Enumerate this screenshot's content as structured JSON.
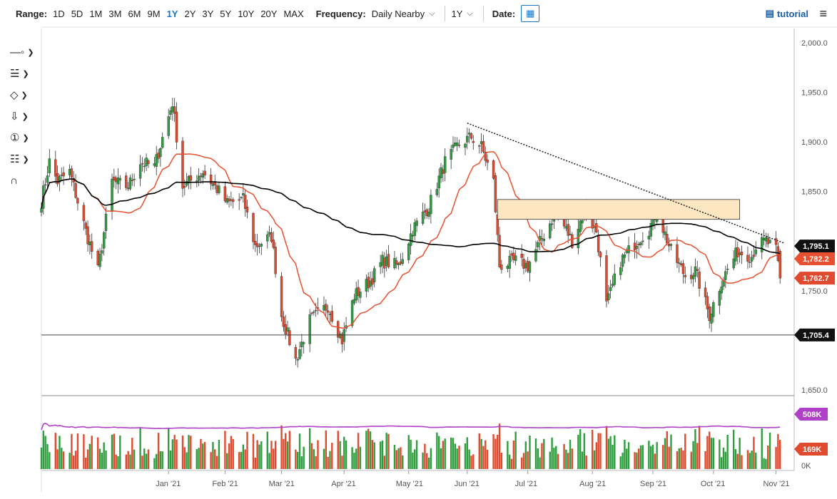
{
  "toolbar": {
    "range_label": "Range:",
    "ranges": [
      "1D",
      "5D",
      "1M",
      "3M",
      "6M",
      "9M",
      "1Y",
      "2Y",
      "3Y",
      "5Y",
      "10Y",
      "20Y",
      "MAX"
    ],
    "active_range": "1Y",
    "frequency_label": "Frequency:",
    "frequency_value": "Daily Nearby",
    "period_value": "1Y",
    "date_label": "Date:",
    "tutorial_label": "tutorial"
  },
  "colors": {
    "up": "#2e9e3e",
    "down": "#e04a2f",
    "ma_fast": "#e8502f",
    "ma_slow": "#000000",
    "volume_ma": "#b040c8",
    "zone_fill": "#fde6c2",
    "accent": "#1a73c7"
  },
  "chart_data": {
    "type": "candlestick",
    "instrument_frequency": "Daily Nearby",
    "x_labels": [
      "Jan '21",
      "Feb '21",
      "Mar '21",
      "Apr '21",
      "May '21",
      "Jun '21",
      "Jul '21",
      "Aug '21",
      "Sep '21",
      "Oct '21",
      "Nov '21"
    ],
    "y_ticks": [
      "2,000.0",
      "1,950.0",
      "1,900.0",
      "1,850.0",
      "1,750.0",
      "1,650.0"
    ],
    "ylim": [
      1650,
      2000
    ],
    "price_badges": [
      {
        "label": "1,795.1",
        "value": 1795.1,
        "color": "#111111"
      },
      {
        "label": "1,782.2",
        "value": 1782.2,
        "color": "#e8502f"
      },
      {
        "label": "1,762.7",
        "value": 1762.7,
        "color": "#e04a2f"
      },
      {
        "label": "1,705.4",
        "value": 1705.4,
        "color": "#111111"
      }
    ],
    "horizontal_line": 1705.4,
    "resistance_zone": {
      "start": "Jun '21",
      "end": "Oct '21",
      "low": 1822,
      "high": 1842
    },
    "trendline": {
      "from": {
        "date": "Jun '21",
        "value": 1919
      },
      "to": {
        "date": "Nov '21",
        "value": 1798
      }
    },
    "anchor_prices": [
      [
        "2020-11-02",
        1840
      ],
      [
        "2020-11-06",
        1880
      ],
      [
        "2020-11-10",
        1860
      ],
      [
        "2020-11-16",
        1870
      ],
      [
        "2020-11-24",
        1810
      ],
      [
        "2020-11-30",
        1770
      ],
      [
        "2020-12-07",
        1860
      ],
      [
        "2020-12-15",
        1855
      ],
      [
        "2020-12-21",
        1880
      ],
      [
        "2020-12-28",
        1875
      ],
      [
        "2021-01-06",
        1940
      ],
      [
        "2021-01-11",
        1855
      ],
      [
        "2021-01-21",
        1870
      ],
      [
        "2021-01-29",
        1850
      ],
      [
        "2021-02-02",
        1838
      ],
      [
        "2021-02-10",
        1842
      ],
      [
        "2021-02-16",
        1795
      ],
      [
        "2021-02-24",
        1805
      ],
      [
        "2021-03-01",
        1725
      ],
      [
        "2021-03-08",
        1680
      ],
      [
        "2021-03-15",
        1720
      ],
      [
        "2021-03-24",
        1735
      ],
      [
        "2021-03-31",
        1700
      ],
      [
        "2021-04-06",
        1745
      ],
      [
        "2021-04-14",
        1760
      ],
      [
        "2021-04-20",
        1780
      ],
      [
        "2021-04-28",
        1775
      ],
      [
        "2021-05-05",
        1812
      ],
      [
        "2021-05-13",
        1835
      ],
      [
        "2021-05-21",
        1880
      ],
      [
        "2021-05-28",
        1898
      ],
      [
        "2021-06-03",
        1905
      ],
      [
        "2021-06-08",
        1895
      ],
      [
        "2021-06-14",
        1860
      ],
      [
        "2021-06-17",
        1775
      ],
      [
        "2021-06-25",
        1780
      ],
      [
        "2021-07-01",
        1775
      ],
      [
        "2021-07-06",
        1795
      ],
      [
        "2021-07-15",
        1830
      ],
      [
        "2021-07-23",
        1800
      ],
      [
        "2021-07-29",
        1830
      ],
      [
        "2021-08-04",
        1810
      ],
      [
        "2021-08-09",
        1735
      ],
      [
        "2021-08-16",
        1780
      ],
      [
        "2021-08-24",
        1800
      ],
      [
        "2021-08-30",
        1812
      ],
      [
        "2021-09-03",
        1830
      ],
      [
        "2021-09-10",
        1790
      ],
      [
        "2021-09-17",
        1765
      ],
      [
        "2021-09-22",
        1770
      ],
      [
        "2021-09-29",
        1725
      ],
      [
        "2021-10-05",
        1760
      ],
      [
        "2021-10-13",
        1790
      ],
      [
        "2021-10-20",
        1785
      ],
      [
        "2021-10-22",
        1795
      ],
      [
        "2021-10-27",
        1800
      ],
      [
        "2021-11-01",
        1790
      ],
      [
        "2021-11-03",
        1762
      ]
    ],
    "ma_fast_label": "1,782.2",
    "ma_slow_label": "1,795.1",
    "volume": {
      "y_ticks": [
        "0K"
      ],
      "badges": [
        {
          "label": "508K",
          "value": 508,
          "color": "#b040c8"
        },
        {
          "label": "169K",
          "value": 169,
          "color": "#e04a2f"
        }
      ]
    }
  }
}
